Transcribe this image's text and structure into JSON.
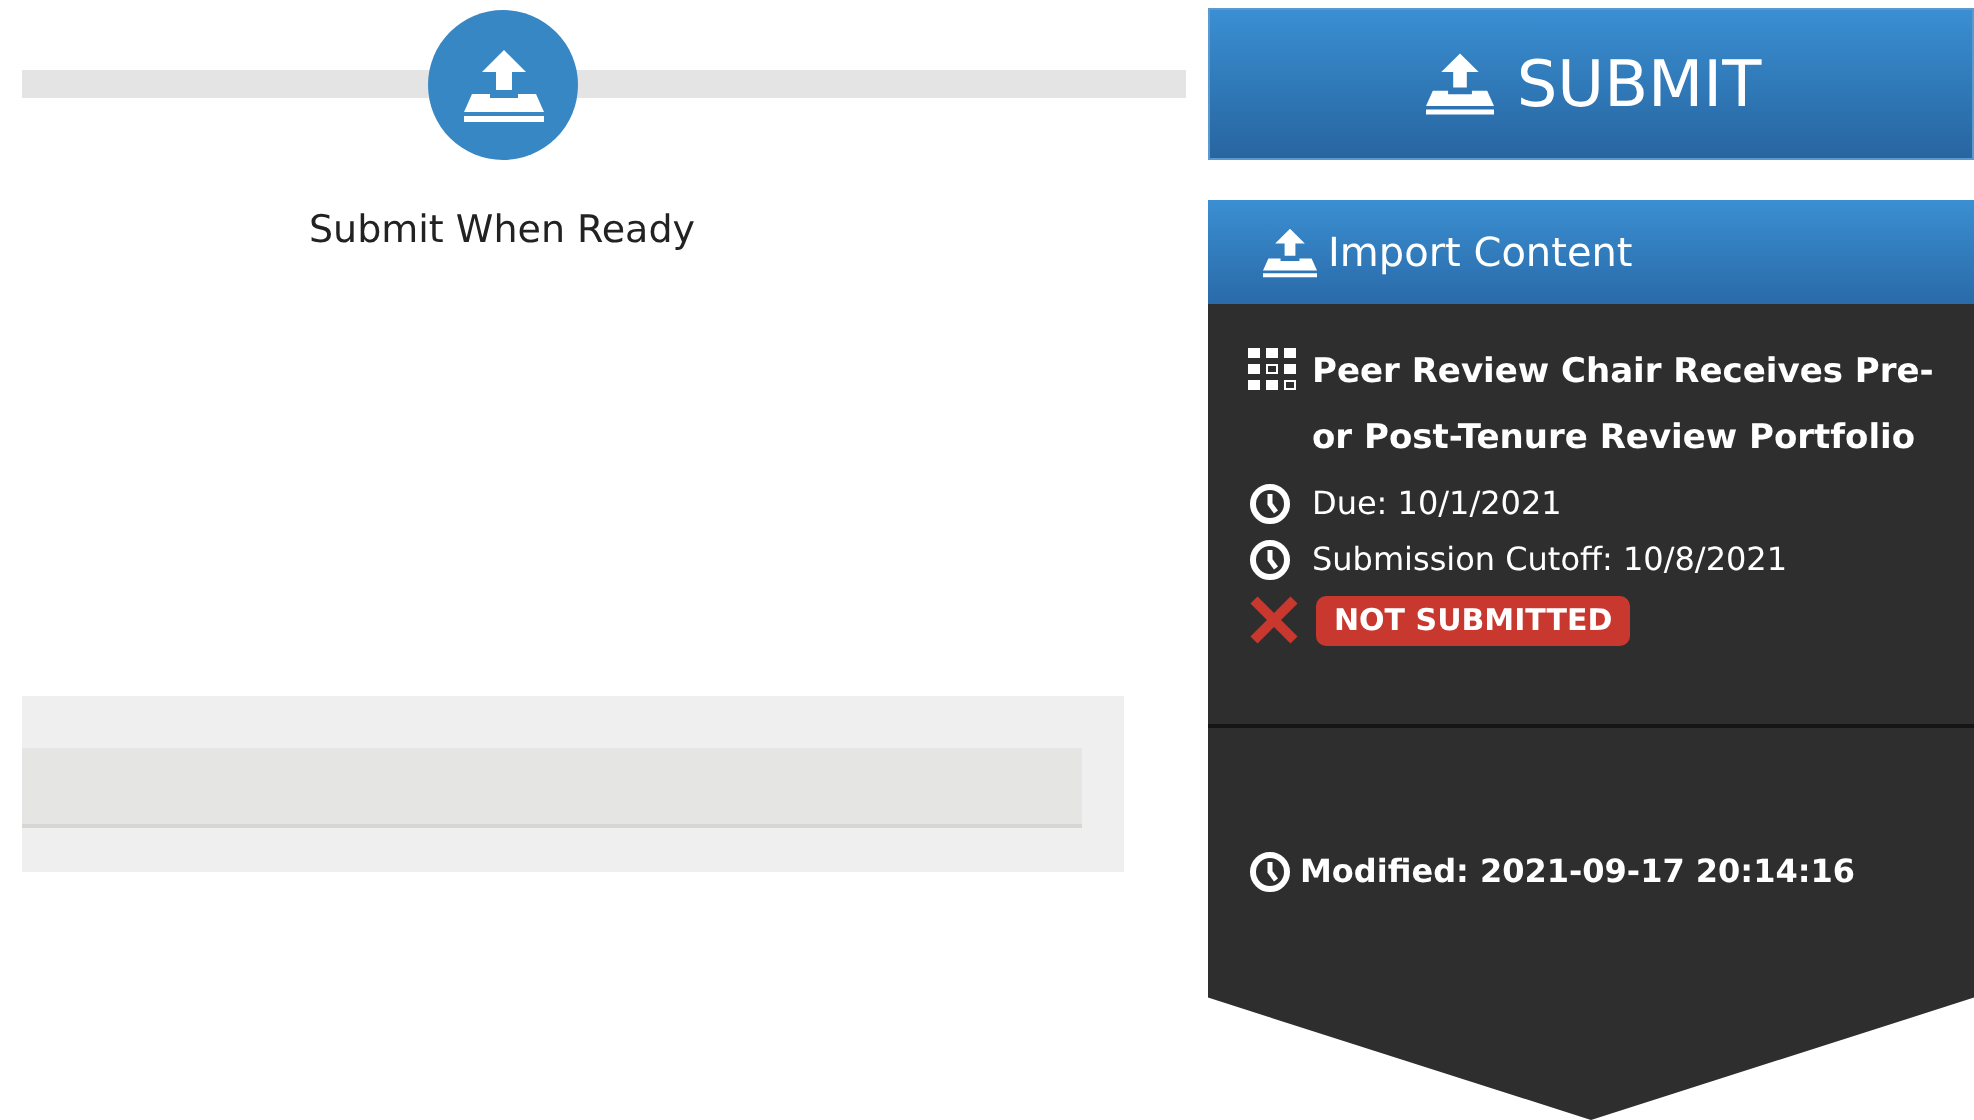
{
  "progress": {
    "step_label": "Submit When Ready"
  },
  "submit_button": {
    "label": "SUBMIT"
  },
  "import_button": {
    "label": "Import Content"
  },
  "item": {
    "title": "Peer Review Chair Receives Pre-or Post-Tenure Review Portfolio",
    "dates": [
      {
        "label": "Due: 10/1/2021"
      },
      {
        "label": "Submission Cutoff: 10/8/2021"
      }
    ],
    "status": {
      "submitted": false,
      "label": "NOT SUBMITTED"
    }
  },
  "modified": "Modified: 2021-09-17 20:14:16"
}
